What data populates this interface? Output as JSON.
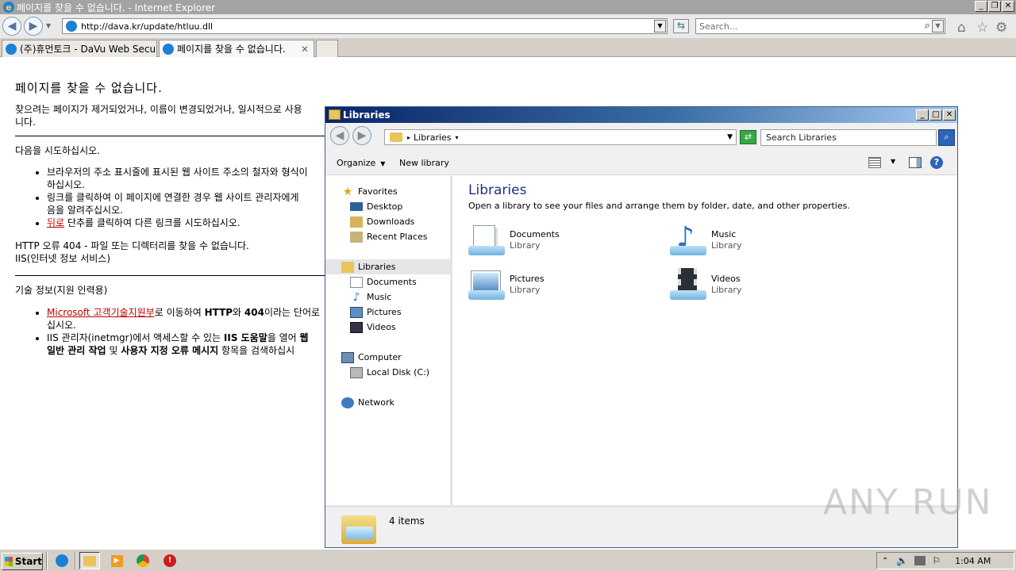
{
  "ie": {
    "title": "페이지를 찾을 수 없습니다. - Internet Explorer",
    "address": "http://dava.kr/update/htluu.dll",
    "search_placeholder": "Search...",
    "tabs": [
      {
        "label": "(주)휴먼토크 - DaVu Web Secu..."
      },
      {
        "label": "페이지를 찾을 수 없습니다."
      }
    ]
  },
  "page": {
    "heading": "페이지를 찾을 수 없습니다.",
    "intro_line1": "찾으려는 페이지가 제거되었거나, 이름이 변경되었거나, 일시적으로 사용",
    "intro_line2": "니다.",
    "try_label": "다음을 시도하십시오.",
    "bullets": [
      {
        "l1": "브라우저의 주소 표시줄에 표시된 웹 사이트 주소의 철자와 형식이",
        "l2": "하십시오."
      },
      {
        "l1": "링크를 클릭하여 이 페이지에 연결한 경우 웹 사이트 관리자에게",
        "l2": "음을 알려주십시오."
      },
      {
        "link": "뒤로",
        "rest": " 단추를 클릭하여 다른 링크를 시도하십시오."
      }
    ],
    "http_error": "HTTP 오류 404 - 파일 또는 디렉터리를 찾을 수 없습니다.",
    "iis": "IIS(인터넷 정보 서비스)",
    "tech_label": "기술 정보(지원 인력용)",
    "tech1_link": "Microsoft 고객기술지원부",
    "tech1_a": "로 이동하여 ",
    "tech1_b": "HTTP",
    "tech1_c": "와 ",
    "tech1_d": "404",
    "tech1_e": "이라는 단어로",
    "tech1_l2": "십시오.",
    "tech2_a": "IIS 관리자(inetmgr)에서 액세스할 수 있는 ",
    "tech2_b": "IIS 도움말",
    "tech2_c": "을 열어 ",
    "tech2_d": "웹",
    "tech2_l2a": "일반 관리 작업",
    "tech2_l2b": " 및 ",
    "tech2_l2c": "사용자 지정 오류 메시지",
    "tech2_l2d": " 항목을 검색하십시"
  },
  "explorer": {
    "title": "Libraries",
    "crumb": "Libraries",
    "search_placeholder": "Search Libraries",
    "toolbar": {
      "organize": "Organize",
      "new_library": "New library"
    },
    "sidebar": {
      "favorites": "Favorites",
      "favorites_items": [
        "Desktop",
        "Downloads",
        "Recent Places"
      ],
      "libraries": "Libraries",
      "libraries_items": [
        "Documents",
        "Music",
        "Pictures",
        "Videos"
      ],
      "computer": "Computer",
      "computer_items": [
        "Local Disk (C:)"
      ],
      "network": "Network"
    },
    "main": {
      "title": "Libraries",
      "subtitle": "Open a library to see your files and arrange them by folder, date, and other properties.",
      "libraries": [
        {
          "name": "Documents",
          "type": "Library"
        },
        {
          "name": "Music",
          "type": "Library"
        },
        {
          "name": "Pictures",
          "type": "Library"
        },
        {
          "name": "Videos",
          "type": "Library"
        }
      ]
    },
    "status": "4 items"
  },
  "taskbar": {
    "start": "Start",
    "clock": "1:04 AM"
  },
  "watermark": "ANY RUN"
}
